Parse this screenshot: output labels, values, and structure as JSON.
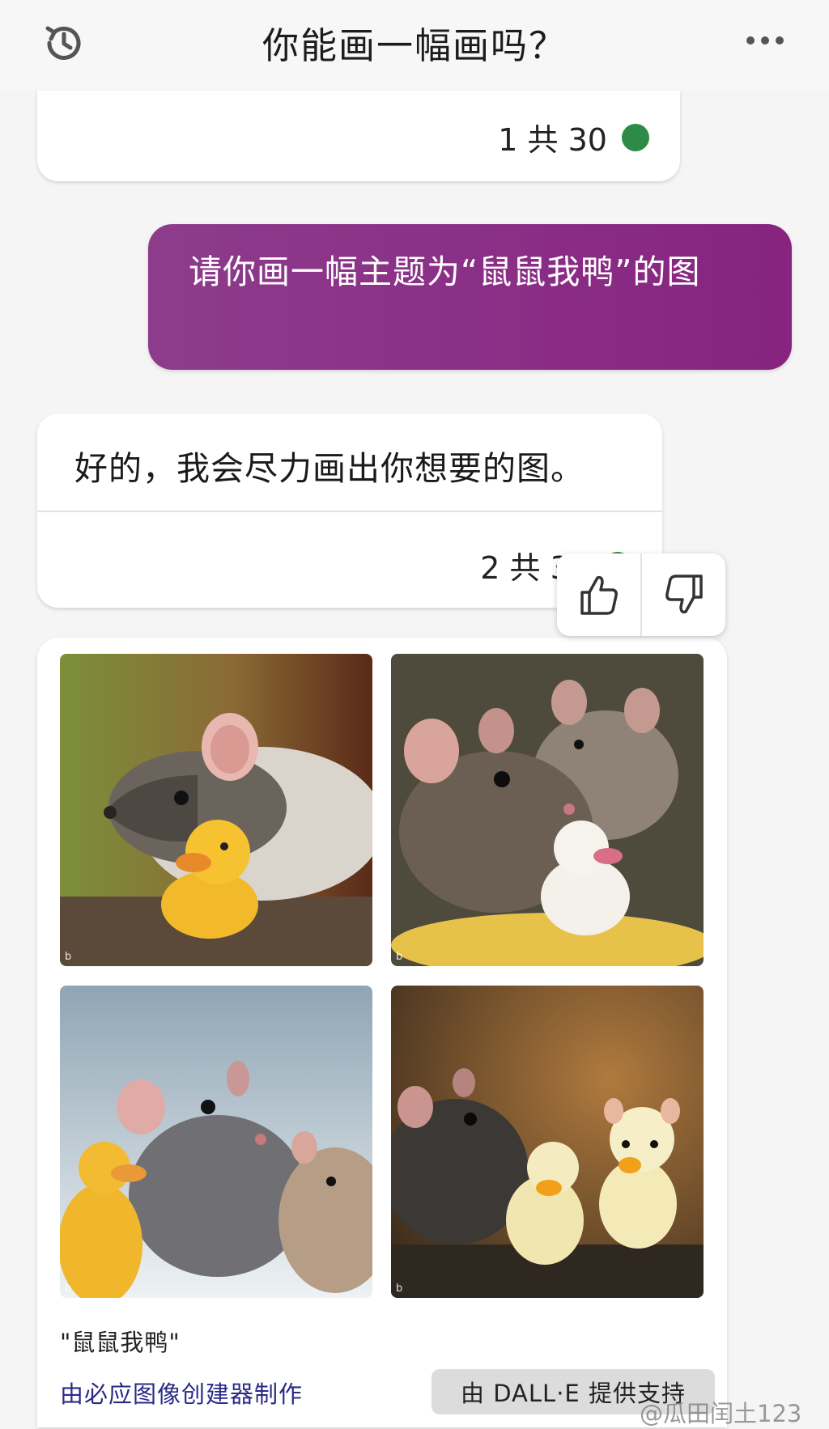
{
  "header": {
    "title": "你能画一幅画吗？",
    "history_icon": "history-clock-icon",
    "more_icon": "more-dots-icon"
  },
  "previous_card": {
    "counter": "1 共 30"
  },
  "user_message": {
    "text": "请你画一幅主题为“鼠鼠我鸭”的图"
  },
  "bot_message": {
    "text": "好的，我会尽力画出你想要的图。",
    "counter": "2 共 30"
  },
  "feedback": {
    "like_icon": "thumbs-up-icon",
    "dislike_icon": "thumbs-down-icon"
  },
  "image_card": {
    "images": [
      {
        "alt": "rat with yellow rubber duck"
      },
      {
        "alt": "two rats with white duck"
      },
      {
        "alt": "rats with yellow duck"
      },
      {
        "alt": "rat with two small ducks"
      }
    ],
    "caption": "\"鼠鼠我鸭\"",
    "maker_link": "由必应图像创建器制作",
    "powered_by": "由 DALL·E 提供支持"
  },
  "watermark": "@瓜田闰土123",
  "colors": {
    "accent_purple": "#8a2d86",
    "status_green": "#2e8b47",
    "link_blue": "#2b2a87"
  }
}
